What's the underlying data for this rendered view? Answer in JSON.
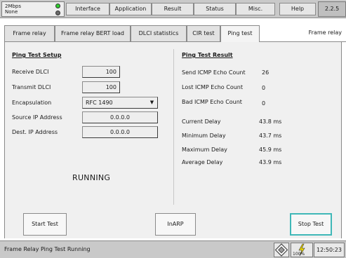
{
  "status": {
    "line1": "2Mbps",
    "line2": "None"
  },
  "main_tabs": [
    "Interface",
    "Application",
    "Result",
    "Status",
    "Misc.",
    "Help"
  ],
  "version": "2.2.5",
  "sub_tabs": [
    "Frame relay",
    "Frame relay BERT load",
    "DLCI statistics",
    "CIR test",
    "Ping test"
  ],
  "active_sub_tab": "Ping test",
  "sub_tab_title": "Frame relay",
  "setup": {
    "title": "Ping Test Setup",
    "fields": [
      {
        "label": "Receive DLCI",
        "value": "100"
      },
      {
        "label": "Transmit DLCI",
        "value": "100"
      },
      {
        "label": "Encapsulation",
        "value": "RFC 1490"
      },
      {
        "label": "Source IP Address",
        "value": "0.0.0.0"
      },
      {
        "label": "Dest. IP Address",
        "value": "0.0.0.0"
      }
    ]
  },
  "result": {
    "title": "Ping Test Result",
    "rows": [
      {
        "label": "Send ICMP Echo Count",
        "value": "26"
      },
      {
        "label": "Lost ICMP Echo Count",
        "value": "0"
      },
      {
        "label": "Bad ICMP Echo Count",
        "value": "0"
      },
      {
        "label": "Current Delay",
        "value": "43.8 ms"
      },
      {
        "label": "Minimum Delay",
        "value": "43.7 ms"
      },
      {
        "label": "Maximum Delay",
        "value": "45.9 ms"
      },
      {
        "label": "Average Delay",
        "value": "43.9 ms"
      }
    ]
  },
  "state_text": "RUNNING",
  "buttons": {
    "start": "Start Test",
    "inarp": "InARP",
    "stop": "Stop Test"
  },
  "footer": {
    "message": "Frame Relay Ping Test Running",
    "battery": "100%",
    "time": "12:50:23"
  },
  "colors": {
    "led_active": "#2fcf2f",
    "led_inactive": "#6b6b6b",
    "stop_highlight": "#3fb8b8",
    "battery_bolt": "#e8d400"
  },
  "icons": [
    "dropdown-arrow-icon",
    "network-icon",
    "battery-charging-icon"
  ]
}
